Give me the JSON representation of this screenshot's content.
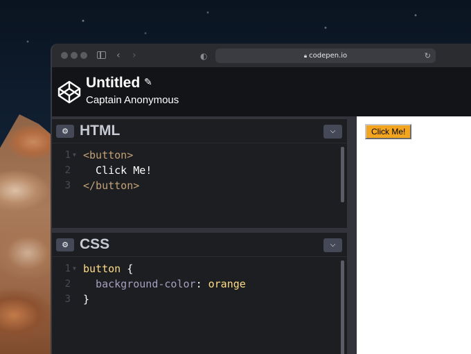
{
  "browser": {
    "url": "codepen.io"
  },
  "pen": {
    "title": "Untitled",
    "author": "Captain Anonymous"
  },
  "editors": {
    "html": {
      "title": "HTML",
      "lines": [
        {
          "num": "1",
          "text": "<button>"
        },
        {
          "num": "2",
          "text": "  Click Me!"
        },
        {
          "num": "3",
          "text": "</button>"
        }
      ]
    },
    "css": {
      "title": "CSS",
      "lines": [
        {
          "num": "1",
          "selector": "button",
          "brace": " {"
        },
        {
          "num": "2",
          "property": "  background-color",
          "colon": ": ",
          "value": "orange"
        },
        {
          "num": "3",
          "close": "}"
        }
      ]
    }
  },
  "preview": {
    "button_label": "Click Me!",
    "button_color": "#f3a51f"
  },
  "colors": {
    "editor_bg": "#1d1e22",
    "header_bg": "#131417",
    "tag": "#c2a276",
    "selector": "#ffdd86",
    "property": "#a79fc0"
  },
  "icons": {
    "logo": "codepen-logo-icon",
    "edit": "pencil-icon",
    "settings": "gear-icon",
    "collapse": "chevron-down-icon"
  }
}
